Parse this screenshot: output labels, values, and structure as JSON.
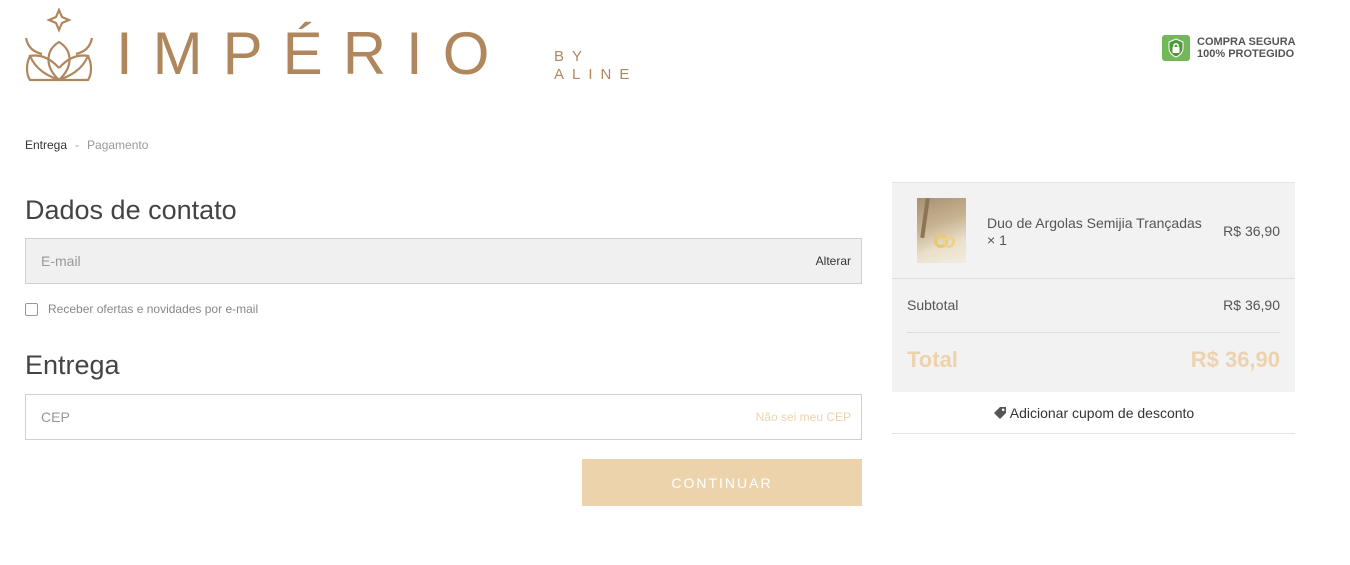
{
  "header": {
    "logo_word": "IMPÉRIO",
    "logo_by": "BY",
    "logo_aline": "ALINE",
    "secure_line1": "COMPRA SEGURA",
    "secure_line2": "100% PROTEGIDO"
  },
  "breadcrumb": {
    "step1": "Entrega",
    "separator": "-",
    "step2": "Pagamento"
  },
  "contact": {
    "title": "Dados de contato",
    "email_placeholder": "E-mail",
    "change_label": "Alterar",
    "offers_label": "Receber ofertas e novidades por e-mail"
  },
  "delivery": {
    "title": "Entrega",
    "cep_placeholder": "CEP",
    "cep_link": "Não sei meu CEP"
  },
  "continue_label": "CONTINUAR",
  "summary": {
    "item_name": "Duo de Argolas Semijia Trançadas × 1",
    "item_price": "R$ 36,90",
    "subtotal_label": "Subtotal",
    "subtotal_value": "R$ 36,90",
    "total_label": "Total",
    "total_value": "R$ 36,90",
    "coupon_label": "Adicionar cupom de desconto"
  },
  "icons": {
    "logo_mark": "lotus-star-icon",
    "secure": "shield-lock-icon",
    "coupon": "tag-icon"
  },
  "colors": {
    "brand": "#b0875d",
    "accent": "#ecd3ab",
    "secure_green": "#74b75a"
  }
}
